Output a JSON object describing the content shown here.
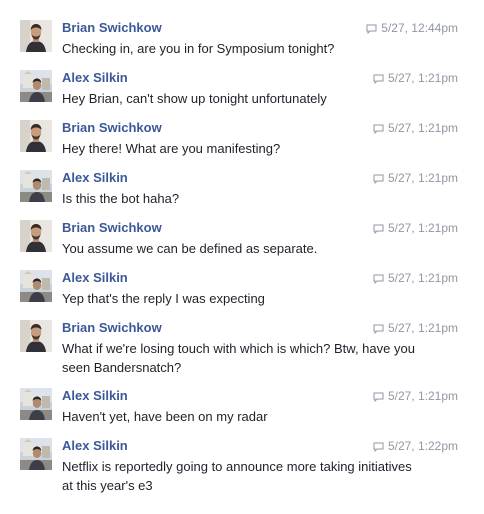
{
  "people": {
    "brian": {
      "name": "Brian Swichkow",
      "avatar_icon": "profile-photo-brian"
    },
    "alex": {
      "name": "Alex Silkin",
      "avatar_icon": "profile-photo-alex"
    }
  },
  "messages": [
    {
      "sender": "Brian Swichkow",
      "time": "5/27, 12:44pm",
      "text": "Checking in, are you in for Symposium tonight?"
    },
    {
      "sender": "Alex Silkin",
      "time": "5/27, 1:21pm",
      "text": "Hey Brian, can't show up tonight unfortunately"
    },
    {
      "sender": "Brian Swichkow",
      "time": "5/27, 1:21pm",
      "text": "Hey there! What are you manifesting?"
    },
    {
      "sender": "Alex Silkin",
      "time": "5/27, 1:21pm",
      "text": "Is this the bot haha?"
    },
    {
      "sender": "Brian Swichkow",
      "time": "5/27, 1:21pm",
      "text": "You assume we can be defined as separate."
    },
    {
      "sender": "Alex Silkin",
      "time": "5/27, 1:21pm",
      "text": "Yep that's the reply I was expecting"
    },
    {
      "sender": "Brian Swichkow",
      "time": "5/27, 1:21pm",
      "text": "What if we're losing touch with which is which? Btw, have you seen Bandersnatch?"
    },
    {
      "sender": "Alex Silkin",
      "time": "5/27, 1:21pm",
      "text": "Haven't yet, have been on my radar"
    },
    {
      "sender": "Alex Silkin",
      "time": "5/27, 1:22pm",
      "text": "Netflix is reportedly going to announce more taking initiatives at this year's e3"
    }
  ],
  "colors": {
    "sender_name": "#3b5998",
    "timestamp": "#9197a3",
    "message_text": "#1d2129"
  }
}
